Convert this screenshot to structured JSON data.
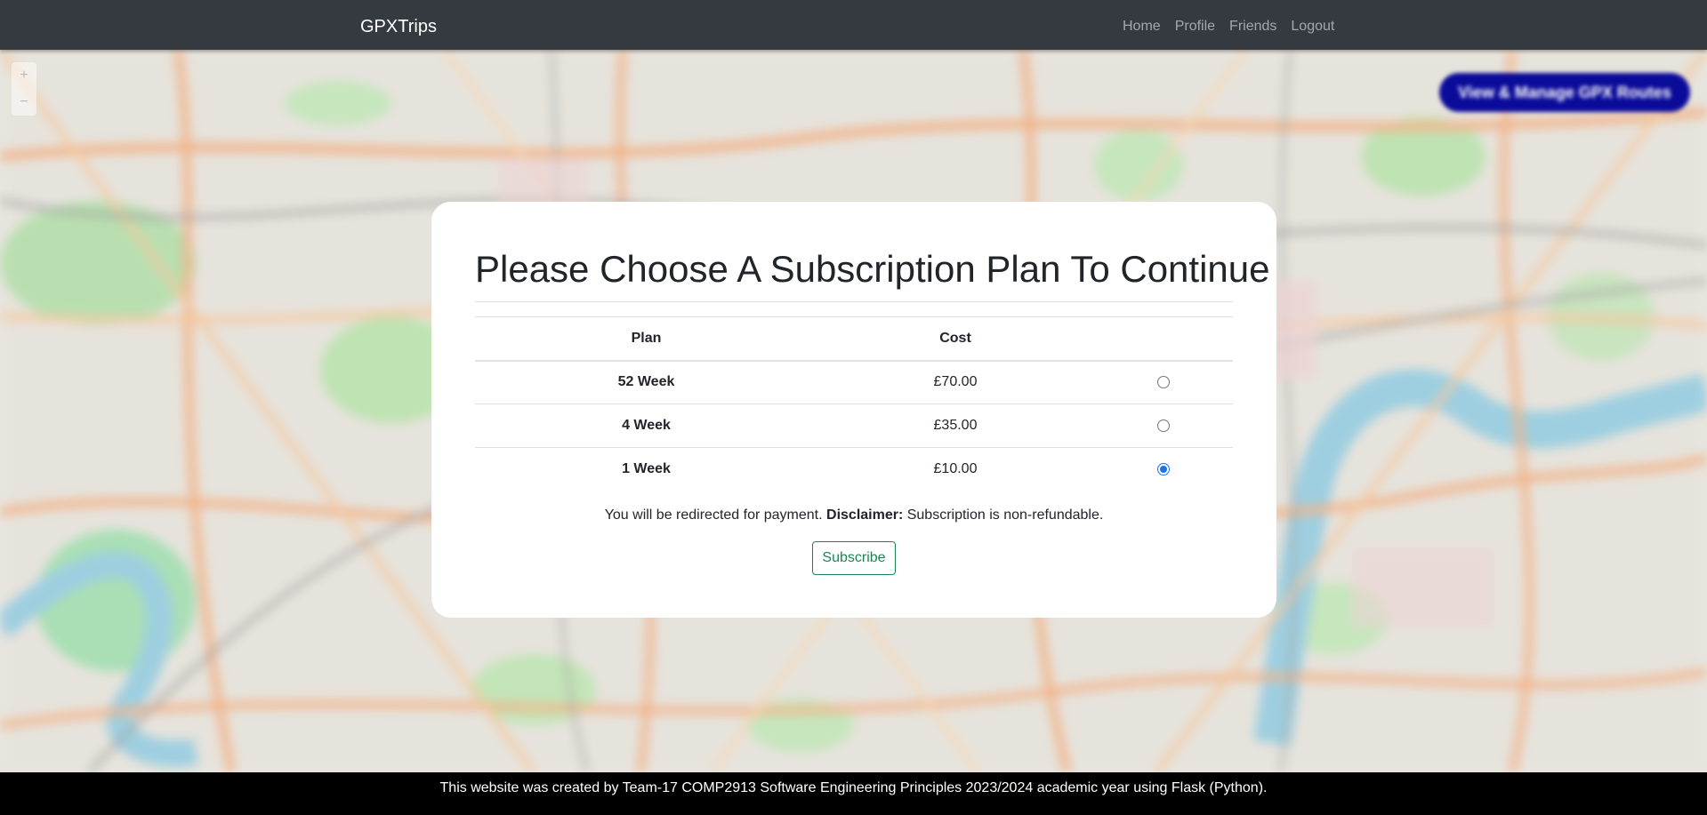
{
  "navbar": {
    "brand": "GPXTrips",
    "links": [
      "Home",
      "Profile",
      "Friends",
      "Logout"
    ]
  },
  "map": {
    "zoom_in": "+",
    "zoom_out": "−",
    "routes_button": "View & Manage GPX Routes"
  },
  "card": {
    "title": "Please Choose A Subscription Plan To Continue",
    "table": {
      "headers": [
        "Plan",
        "Cost",
        ""
      ],
      "rows": [
        {
          "plan": "52 Week",
          "cost": "£70.00",
          "selected": false
        },
        {
          "plan": "4 Week",
          "cost": "£35.00",
          "selected": false
        },
        {
          "plan": "1 Week",
          "cost": "£10.00",
          "selected": true
        }
      ]
    },
    "note_prefix": "You will be redirected for payment.",
    "note_bold": "Disclaimer:",
    "note_suffix": "Subscription is non-refundable.",
    "subscribe_label": "Subscribe"
  },
  "footer": {
    "text": "This website was created by Team-17 COMP2913 Software Engineering Principles 2023/2024 academic year using Flask (Python)."
  },
  "colors": {
    "navbar": "#343a40",
    "accent_green": "#198754",
    "radio_checked": "#1a73e8",
    "routes_button": "#0b0b9a"
  }
}
